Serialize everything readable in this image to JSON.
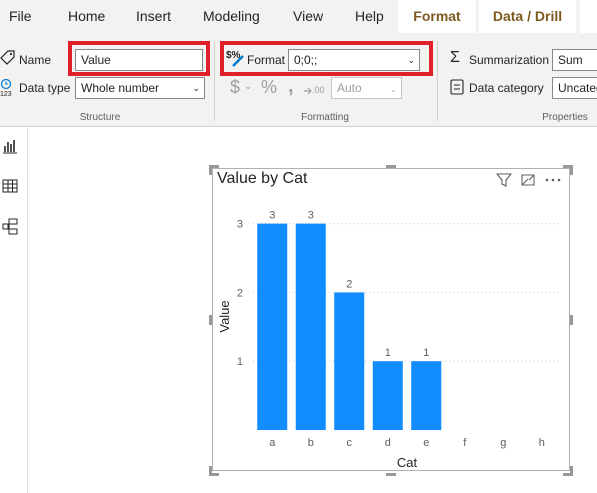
{
  "tabs": [
    "File",
    "Home",
    "Insert",
    "Modeling",
    "View",
    "Help",
    "Format",
    "Data / Drill"
  ],
  "structure": {
    "name_label": "Name",
    "name_value": "Value",
    "datatype_label": "Data type",
    "datatype_value": "Whole number",
    "group_label": "Structure"
  },
  "formatting": {
    "format_label": "Format",
    "format_value": "0;0;;",
    "decimals_value": "Auto",
    "group_label": "Formatting"
  },
  "properties": {
    "summarization_label": "Summarization",
    "summarization_value": "Sum",
    "category_label": "Data category",
    "category_value": "Uncateg",
    "group_label": "Properties"
  },
  "icons": [
    "tag-icon",
    "datatype-icon",
    "format-icon",
    "dollar-icon",
    "percent-icon",
    "comma-icon",
    "decimal-icon",
    "sigma-icon",
    "data-category-icon",
    "report-view-icon",
    "data-view-icon",
    "model-view-icon",
    "filter-icon",
    "focus-mode-icon",
    "more-options-icon"
  ],
  "colors": {
    "bar": "#118dff",
    "highlight": "#e0202b",
    "context_tab": "#7d5a1f"
  },
  "chart_data": {
    "type": "bar",
    "title": "Value by Cat",
    "xlabel": "Cat",
    "ylabel": "Value",
    "categories": [
      "a",
      "b",
      "c",
      "d",
      "e",
      "f",
      "g",
      "h"
    ],
    "values": [
      3,
      3,
      2,
      1,
      1,
      null,
      null,
      null
    ],
    "data_labels": [
      "3",
      "3",
      "2",
      "1",
      "1",
      "",
      "",
      ""
    ],
    "yticks": [
      "1",
      "2",
      "3"
    ],
    "ylim": [
      0,
      3.3
    ],
    "grid": true
  }
}
